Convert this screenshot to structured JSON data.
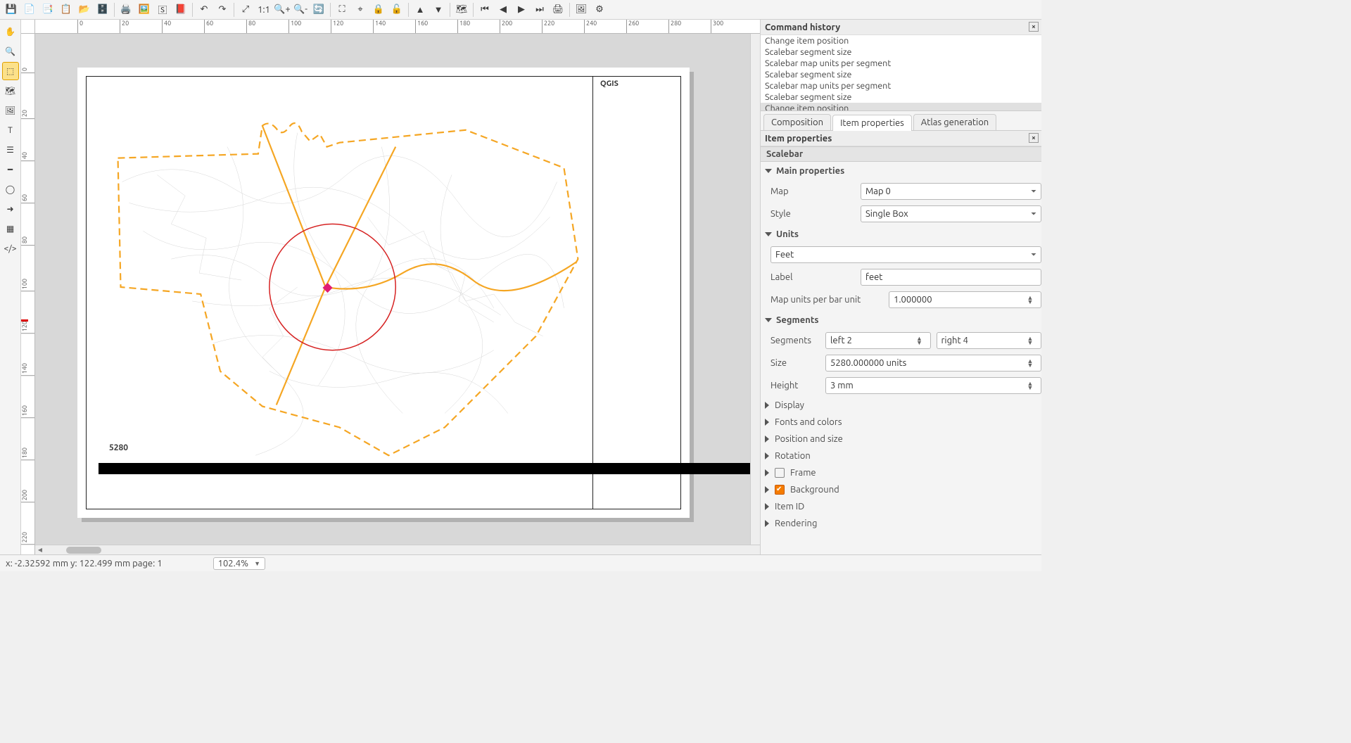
{
  "toolbar_top": {
    "icons": [
      "save-icon",
      "new-layout-icon",
      "duplicate-layout-icon",
      "layout-manager-icon",
      "open-icon",
      "save-template-icon",
      "print-icon",
      "export-image-icon",
      "export-svg-icon",
      "export-pdf-icon",
      "undo-icon",
      "redo-icon",
      "zoom-full-icon",
      "zoom-actual-icon",
      "zoom-in-icon",
      "zoom-out-icon",
      "refresh-icon",
      "zoom-selection-icon",
      "zoom-100-icon",
      "lock-icon",
      "unlock-icon",
      "bring-front-icon",
      "send-back-icon",
      "atlas-toggle-icon",
      "atlas-first-icon",
      "atlas-prev-icon",
      "atlas-next-icon",
      "atlas-last-icon",
      "atlas-print-icon",
      "atlas-export-image-icon",
      "atlas-settings-icon"
    ]
  },
  "left_tools": [
    "pan-icon",
    "zoom-icon",
    "select-icon",
    "add-map-icon",
    "add-image-icon",
    "add-label-icon",
    "add-legend-icon",
    "add-scalebar-icon",
    "add-shape-icon",
    "add-arrow-icon",
    "add-table-icon",
    "add-html-icon"
  ],
  "ruler_h": [
    "0",
    "20",
    "40",
    "60",
    "80",
    "100",
    "120",
    "140",
    "160",
    "180",
    "200",
    "220",
    "240",
    "260",
    "280",
    "300"
  ],
  "ruler_v": [
    "0",
    "20",
    "40",
    "60",
    "80",
    "100",
    "120",
    "140",
    "160",
    "180",
    "200",
    "220"
  ],
  "canvas": {
    "title_label": "QGIS",
    "scale_label": "5280"
  },
  "right": {
    "history_title": "Command history",
    "history": [
      "Change item position",
      "Scalebar segment size",
      "Scalebar map units per segment",
      "Scalebar segment size",
      "Scalebar map units per segment",
      "Scalebar segment size",
      "Change item position"
    ],
    "tabs": {
      "composition": "Composition",
      "item": "Item properties",
      "atlas": "Atlas generation"
    },
    "item_props_title": "Item properties",
    "section": "Scalebar",
    "main_props": {
      "title": "Main properties",
      "map_label": "Map",
      "map_value": "Map 0",
      "style_label": "Style",
      "style_value": "Single Box"
    },
    "units": {
      "title": "Units",
      "unit_value": "Feet",
      "label_label": "Label",
      "label_value": "feet",
      "mub_label": "Map units per bar unit",
      "mub_value": "1.000000"
    },
    "segments": {
      "title": "Segments",
      "seg_label": "Segments",
      "seg_left": "left 2",
      "seg_right": "right 4",
      "size_label": "Size",
      "size_value": "5280.000000 units",
      "height_label": "Height",
      "height_value": "3 mm"
    },
    "collapsed": {
      "display": "Display",
      "fonts": "Fonts and colors",
      "pos": "Position and size",
      "rotation": "Rotation",
      "frame": "Frame",
      "background": "Background",
      "itemid": "Item ID",
      "rendering": "Rendering"
    }
  },
  "status": {
    "coords": "x: -2.32592 mm   y: 122.499 mm   page: 1",
    "zoom": "102.4%"
  },
  "icon_glyphs": {
    "save-icon": "💾",
    "new-layout-icon": "📄",
    "duplicate-layout-icon": "📑",
    "layout-manager-icon": "📋",
    "open-icon": "📂",
    "save-template-icon": "🗄️",
    "print-icon": "🖨️",
    "export-image-icon": "🖼️",
    "export-svg-icon": "🅂",
    "export-pdf-icon": "📕",
    "undo-icon": "↶",
    "redo-icon": "↷",
    "zoom-full-icon": "⤢",
    "zoom-actual-icon": "1:1",
    "zoom-in-icon": "🔍+",
    "zoom-out-icon": "🔍-",
    "refresh-icon": "🔄",
    "zoom-selection-icon": "⛶",
    "zoom-100-icon": "⌖",
    "lock-icon": "🔒",
    "unlock-icon": "🔓",
    "bring-front-icon": "▲",
    "send-back-icon": "▼",
    "atlas-toggle-icon": "🗺",
    "atlas-first-icon": "⏮",
    "atlas-prev-icon": "◀",
    "atlas-next-icon": "▶",
    "atlas-last-icon": "⏭",
    "atlas-print-icon": "🖨",
    "atlas-export-image-icon": "🖼",
    "atlas-settings-icon": "⚙",
    "pan-icon": "✋",
    "zoom-icon": "🔍",
    "select-icon": "⬚",
    "add-map-icon": "🗺",
    "add-image-icon": "🖼",
    "add-label-icon": "T",
    "add-legend-icon": "☰",
    "add-scalebar-icon": "━",
    "add-shape-icon": "◯",
    "add-arrow-icon": "➜",
    "add-table-icon": "▦",
    "add-html-icon": "</>"
  }
}
